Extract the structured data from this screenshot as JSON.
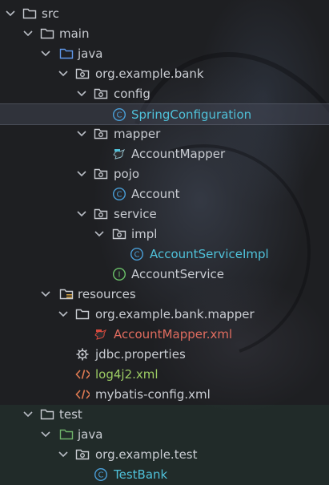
{
  "tree": {
    "src": "src",
    "main": "main",
    "java": "java",
    "pkg_bank": "org.example.bank",
    "config": "config",
    "spring_configuration": "SpringConfiguration",
    "mapper": "mapper",
    "account_mapper": "AccountMapper",
    "pojo": "pojo",
    "account": "Account",
    "service": "service",
    "impl": "impl",
    "account_service_impl": "AccountServiceImpl",
    "account_service": "AccountService",
    "resources": "resources",
    "pkg_bank_mapper": "org.example.bank.mapper",
    "account_mapper_xml": "AccountMapper.xml",
    "jdbc_properties": "jdbc.properties",
    "log4j2_xml": "log4j2.xml",
    "mybatis_config_xml": "mybatis-config.xml",
    "test": "test",
    "test_java": "java",
    "pkg_test": "org.example.test",
    "test_bank": "TestBank"
  },
  "colors": {
    "folder": "#c9ccd2",
    "source_folder": "#5f97e8",
    "test_folder": "#6fb36a",
    "class_icon": "#4a9fd8",
    "interface_icon": "#6cc36a",
    "xml_icon": "#e07b53",
    "mybatis_icon": "#d94a3d",
    "selected_text": "#4fc1d9",
    "modified_text": "#9ccc63",
    "error_text": "#e06c5f"
  }
}
